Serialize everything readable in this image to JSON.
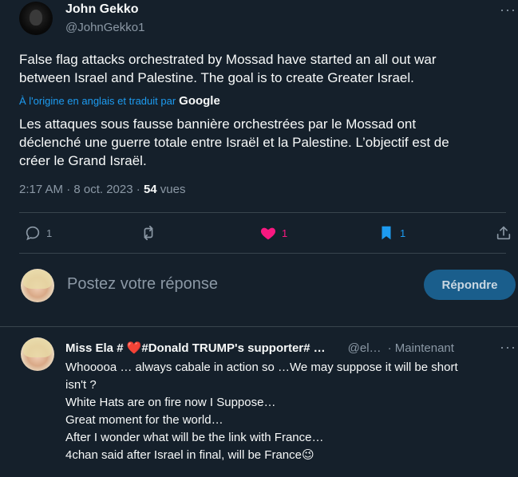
{
  "tweet": {
    "author_name": "John Gekko",
    "author_handle": "@JohnGekko1",
    "more_label": "···",
    "text_line1": "False flag attacks orchestrated by Mossad have started an all out war",
    "text_line2": "between Israel and Palestine. The goal is to create Greater Israel.",
    "translation_note": "À l'origine en anglais et traduit par",
    "translation_provider": "Google",
    "translated_line1": "Les attaques sous fausse bannière orchestrées par le Mossad ont",
    "translated_line2": "déclenché une guerre totale entre Israël et la Palestine. L’objectif est de",
    "translated_line3": "créer le Grand Israël.",
    "timestamp": "2:17 AM · 8 oct. 2023 ·",
    "views_count": "54",
    "views_label": "vues"
  },
  "actions": {
    "reply_count": "1",
    "repost_count": "",
    "like_count": "1",
    "bookmark_count": "1",
    "colors": {
      "like": "#f91880",
      "bookmark": "#1d9bf0",
      "muted": "#8b98a5"
    }
  },
  "composer": {
    "placeholder": "Postez votre réponse",
    "submit_label": "Répondre"
  },
  "reply": {
    "name": "Miss Ela # ❤️#Donald TRUMP's supporter# …",
    "handle": "@el…",
    "time": "· Maintenant",
    "more_label": "···",
    "lines": [
      "Whooooa … always cabale in action so …We may suppose it will be short",
      "isn't ?",
      "White Hats are on fire now I Suppose…",
      "Great moment for the world…",
      "After I wonder what will be the link with France…",
      "4chan said after Israel in final, will be France😉"
    ]
  },
  "theme": {
    "background": "#15202b",
    "accent": "#1d9bf0"
  }
}
